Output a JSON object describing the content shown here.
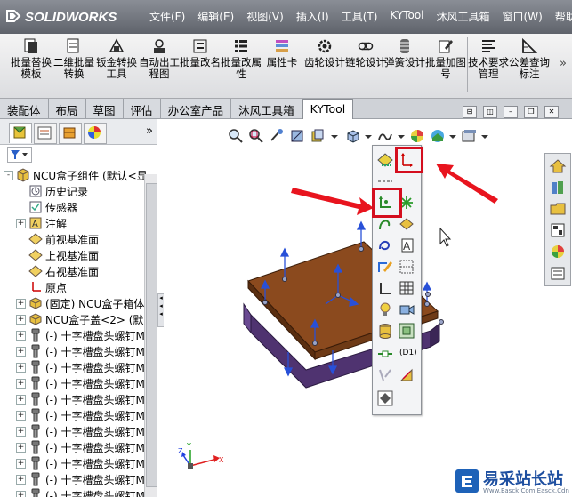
{
  "app": {
    "logo": "SOLIDWORKS"
  },
  "menu": [
    "文件(F)",
    "编辑(E)",
    "视图(V)",
    "插入(I)",
    "工具(T)",
    "KYTool",
    "沐风工具箱",
    "窗口(W)",
    "帮助(H)"
  ],
  "ribbon": {
    "group1": [
      {
        "label": "批量替换模板",
        "icon": "batch-replace-template-icon"
      },
      {
        "label": "二维批量转换",
        "icon": "2d-batch-convert-icon"
      },
      {
        "label": "钣金转换工具",
        "icon": "sheetmetal-convert-icon"
      },
      {
        "label": "自动出工程图",
        "icon": "auto-drawing-icon"
      },
      {
        "label": "批量改名",
        "icon": "batch-rename-icon"
      },
      {
        "label": "批量改属性",
        "icon": "batch-property-icon"
      },
      {
        "label": "属性卡",
        "icon": "property-card-icon"
      }
    ],
    "group2": [
      {
        "label": "齿轮设计",
        "icon": "gear-design-icon"
      },
      {
        "label": "链轮设计",
        "icon": "sprocket-design-icon"
      },
      {
        "label": "弹簧设计",
        "icon": "spring-design-icon"
      },
      {
        "label": "批量加图号",
        "icon": "batch-drawing-number-icon"
      }
    ],
    "group3": [
      {
        "label": "技术要求管理",
        "icon": "tech-requirement-icon"
      },
      {
        "label": "公差查询标注",
        "icon": "tolerance-query-icon"
      }
    ],
    "more": "»"
  },
  "cm_tabs": [
    "装配体",
    "布局",
    "草图",
    "评估",
    "办公室产品",
    "沐风工具箱",
    "KYTool"
  ],
  "cm_active": "KYTool",
  "panel": {
    "more": "»"
  },
  "tree": [
    {
      "label": "NCU盒子组件 (默认<显",
      "exp": "-",
      "indent": 0,
      "icon": "assembly"
    },
    {
      "label": "历史记录",
      "exp": "",
      "indent": 1,
      "icon": "history"
    },
    {
      "label": "传感器",
      "exp": "",
      "indent": 1,
      "icon": "sensor"
    },
    {
      "label": "注解",
      "exp": "+",
      "indent": 1,
      "icon": "annotation"
    },
    {
      "label": "前视基准面",
      "exp": "",
      "indent": 1,
      "icon": "plane"
    },
    {
      "label": "上视基准面",
      "exp": "",
      "indent": 1,
      "icon": "plane"
    },
    {
      "label": "右视基准面",
      "exp": "",
      "indent": 1,
      "icon": "plane"
    },
    {
      "label": "原点",
      "exp": "",
      "indent": 1,
      "icon": "origin"
    },
    {
      "label": "(固定) NCU盒子箱体",
      "exp": "+",
      "indent": 1,
      "icon": "part"
    },
    {
      "label": "NCU盒子盖<2> (默",
      "exp": "+",
      "indent": 1,
      "icon": "part"
    },
    {
      "label": "(-) 十字槽盘头螺钉M",
      "exp": "+",
      "indent": 1,
      "icon": "screw"
    },
    {
      "label": "(-) 十字槽盘头螺钉M",
      "exp": "+",
      "indent": 1,
      "icon": "screw"
    },
    {
      "label": "(-) 十字槽盘头螺钉M",
      "exp": "+",
      "indent": 1,
      "icon": "screw"
    },
    {
      "label": "(-) 十字槽盘头螺钉M",
      "exp": "+",
      "indent": 1,
      "icon": "screw"
    },
    {
      "label": "(-) 十字槽盘头螺钉M",
      "exp": "+",
      "indent": 1,
      "icon": "screw"
    },
    {
      "label": "(-) 十字槽盘头螺钉M",
      "exp": "+",
      "indent": 1,
      "icon": "screw"
    },
    {
      "label": "(-) 十字槽盘头螺钉M",
      "exp": "+",
      "indent": 1,
      "icon": "screw"
    },
    {
      "label": "(-) 十字槽盘头螺钉M",
      "exp": "+",
      "indent": 1,
      "icon": "screw"
    },
    {
      "label": "(-) 十字槽盘头螺钉M",
      "exp": "+",
      "indent": 1,
      "icon": "screw"
    },
    {
      "label": "(-) 十字槽盘头螺钉M",
      "exp": "+",
      "indent": 1,
      "icon": "screw"
    },
    {
      "label": "(-) 十字槽盘头螺钉M",
      "exp": "+",
      "indent": 1,
      "icon": "screw"
    }
  ],
  "flyout": {
    "dimension_label": "(D1)"
  },
  "triad": {
    "x": "X",
    "y": "Y",
    "z": "Z"
  },
  "watermark": {
    "text": "易采站长站",
    "sub": "Www.Easck.Com  Easck.Cdn"
  },
  "colors": {
    "highlight": "#d40e1e",
    "arrow": "#e8141e",
    "box_lid": "#8b4a1e",
    "box_body": "#5a3c78",
    "axis_blue": "#2850d8"
  }
}
